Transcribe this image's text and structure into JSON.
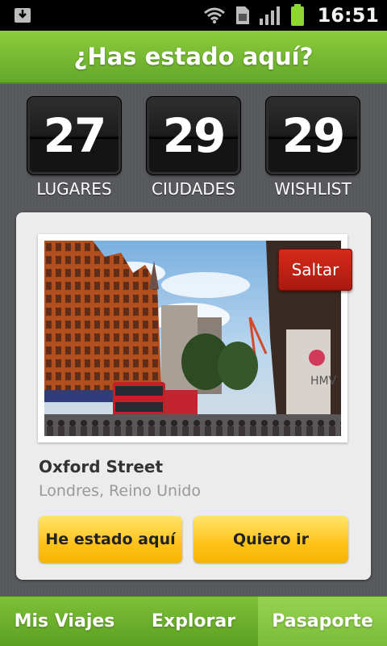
{
  "status_bar": {
    "time": "16:51",
    "icons": [
      "download-icon",
      "wifi-icon",
      "sim-icon",
      "signal-icon",
      "battery-icon"
    ],
    "battery_color": "#8ed632"
  },
  "header": {
    "title": "¿Has estado aquí?"
  },
  "counters": [
    {
      "value": "27",
      "label": "LUGARES"
    },
    {
      "value": "29",
      "label": "CIUDADES"
    },
    {
      "value": "29",
      "label": "WISHLIST"
    }
  ],
  "card": {
    "skip_label": "Saltar",
    "place_name": "Oxford Street",
    "place_location": "Londres, Reino Unido",
    "photo_sign": "HMV",
    "been_here_label": "He estado aquí",
    "want_to_go_label": "Quiero ir"
  },
  "bottom_nav": {
    "items": [
      {
        "label": "Mis Viajes",
        "active": false
      },
      {
        "label": "Explorar",
        "active": false
      },
      {
        "label": "Pasaporte",
        "active": true
      }
    ]
  },
  "colors": {
    "brand_green": "#6cb52c",
    "skip_red": "#c0281a",
    "button_yellow": "#ffc21a"
  }
}
